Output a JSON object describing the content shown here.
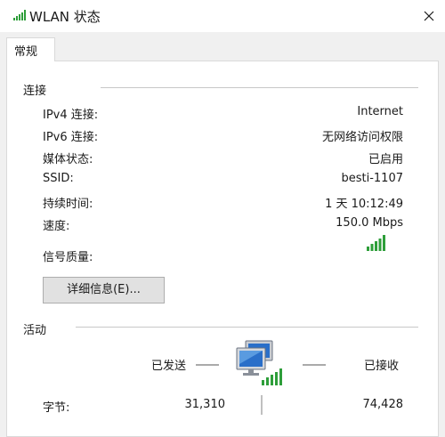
{
  "window": {
    "title": "WLAN 状态"
  },
  "tabs": [
    {
      "label": "常规"
    }
  ],
  "connection": {
    "heading": "连接",
    "rows": [
      {
        "label": "IPv4 连接:",
        "value": "Internet"
      },
      {
        "label": "IPv6 连接:",
        "value": "无网络访问权限"
      },
      {
        "label": "媒体状态:",
        "value": "已启用"
      },
      {
        "label": "SSID:",
        "value": "besti-1107"
      },
      {
        "label": "持续时间:",
        "value": "1 天 10:12:49"
      },
      {
        "label": "速度:",
        "value": "150.0 Mbps"
      }
    ],
    "signal_label": "信号质量:",
    "signal_bars_lit": 5,
    "signal_bars_total": 5,
    "details_button": "详细信息(E)..."
  },
  "activity": {
    "heading": "活动",
    "sent_label": "已发送",
    "received_label": "已接收",
    "bytes_label": "字节:",
    "bytes_sent": "31,310",
    "bytes_received": "74,428"
  },
  "colors": {
    "signal_green": "#2e9e3a",
    "monitor_blue": "#2a6fc9"
  },
  "icons": {
    "title": "signal-bars-icon",
    "close": "close-icon",
    "network": "network-computers-icon"
  }
}
